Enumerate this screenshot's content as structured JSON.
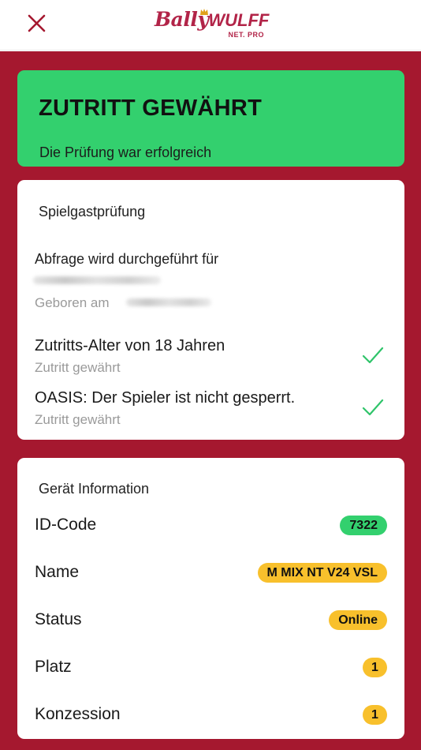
{
  "header": {
    "close_icon": "close-icon",
    "logo_bally": "Bally",
    "logo_wulff": "WULFF",
    "logo_sub": "NET. PRO"
  },
  "colors": {
    "brand": "#a5182f",
    "success": "#33d06e",
    "warning": "#f8c02c"
  },
  "banner": {
    "title": "ZUTRITT GEWÄHRT",
    "subtitle": "Die Prüfung war erfolgreich"
  },
  "guest_check": {
    "heading": "Spielgastprüfung",
    "query_label": "Abfrage wird durchgeführt für",
    "born_label": "Geboren am",
    "checks": [
      {
        "title": "Zutritts-Alter von 18 Jahren",
        "status": "Zutritt gewährt",
        "icon": "checkmark-icon"
      },
      {
        "title": "OASIS: Der Spieler ist nicht gesperrt.",
        "status": "Zutritt gewährt",
        "icon": "checkmark-icon"
      }
    ]
  },
  "device_info": {
    "heading": "Gerät Information",
    "rows": [
      {
        "label": "ID-Code",
        "value": "7322"
      },
      {
        "label": "Name",
        "value": "M MIX NT V24 VSL"
      },
      {
        "label": "Status",
        "value": "Online"
      },
      {
        "label": "Platz",
        "value": "1"
      },
      {
        "label": "Konzession",
        "value": "1"
      }
    ]
  }
}
